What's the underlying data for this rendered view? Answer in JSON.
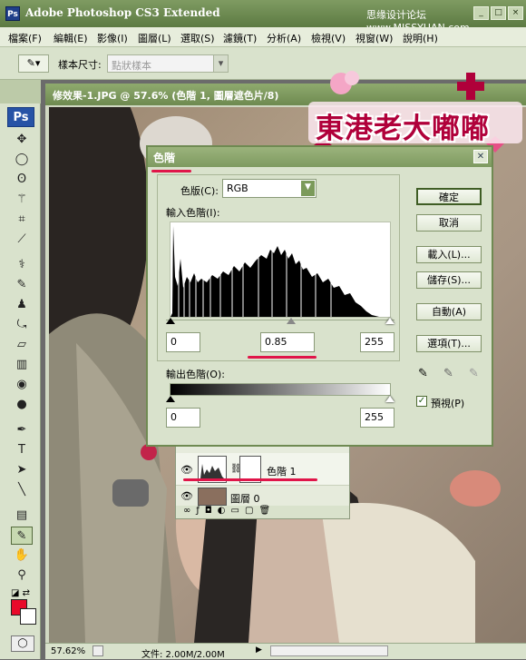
{
  "app": {
    "title": "Adobe Photoshop CS3 Extended",
    "site": "思缘设计论坛 www.MISSYUAN.com",
    "window_buttons": [
      "_",
      "□",
      "×"
    ]
  },
  "menu": [
    "檔案(F)",
    "編輯(E)",
    "影像(I)",
    "圖層(L)",
    "選取(S)",
    "濾鏡(T)",
    "分析(A)",
    "檢視(V)",
    "視窗(W)",
    "說明(H)"
  ],
  "options": {
    "sample_label": "樣本尺寸:",
    "sample_value": "點狀樣本"
  },
  "document": {
    "title": "修效果-1.JPG @ 57.6% (色階 1, 圖層遮色片/8)",
    "zoom": "57.62%",
    "file_info": "文件: 2.00M/2.00M"
  },
  "logo": {
    "text": "東港老大嘟嘟"
  },
  "levels": {
    "title": "色階",
    "channel_label": "色版(C):",
    "channel_value": "RGB",
    "input_label": "輸入色階(I):",
    "input_black": "0",
    "input_gamma": "0.85",
    "input_white": "255",
    "output_label": "輸出色階(O):",
    "output_black": "0",
    "output_white": "255",
    "buttons": {
      "ok": "確定",
      "cancel": "取消",
      "load": "載入(L)...",
      "save": "儲存(S)...",
      "auto": "自動(A)",
      "options": "選項(T)..."
    },
    "preview_label": "預視(P)",
    "preview_checked": "✓"
  },
  "layers": {
    "items": [
      {
        "name": "色階 1"
      },
      {
        "name": "圖層 0"
      }
    ]
  },
  "colors": {
    "accent": "#e01549",
    "foreground": "#e8092a",
    "background": "#ffffff"
  }
}
